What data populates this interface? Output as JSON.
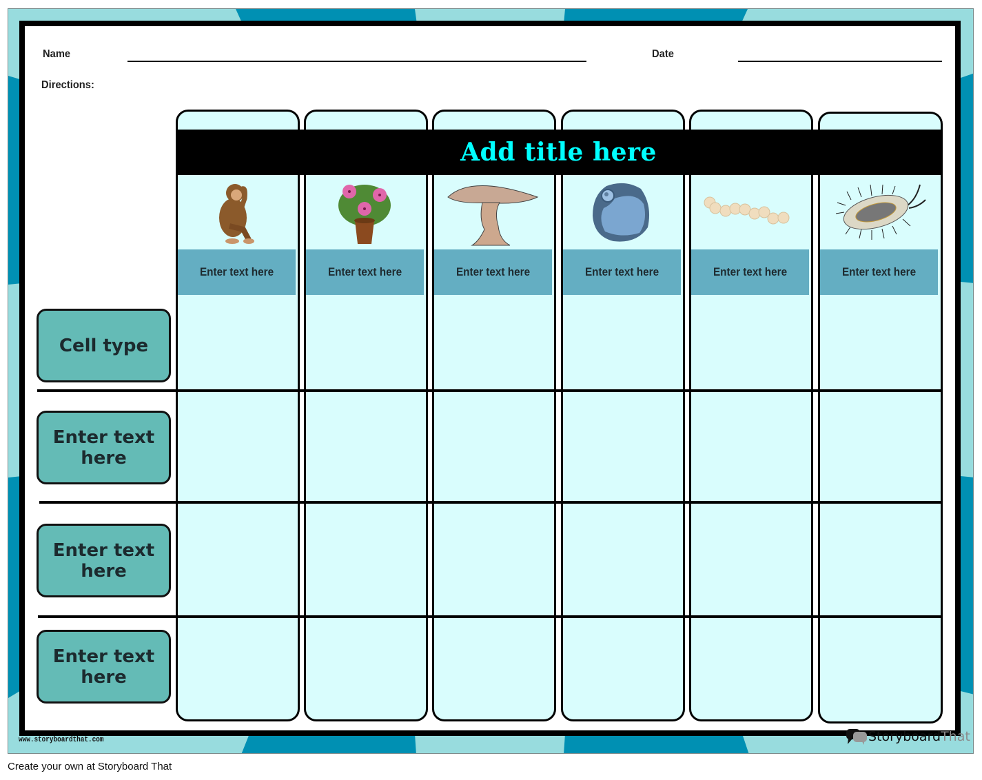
{
  "worksheet": {
    "name_label": "Name",
    "date_label": "Date",
    "directions_label": "Directions:",
    "title": "Add title here",
    "columns": [
      {
        "image": "monkey-icon",
        "header": "Enter text here"
      },
      {
        "image": "potted-flower-icon",
        "header": "Enter text here"
      },
      {
        "image": "mushroom-icon",
        "header": "Enter text here"
      },
      {
        "image": "animal-cell-icon",
        "header": "Enter text here"
      },
      {
        "image": "streptococcus-chain-icon",
        "header": "Enter text here"
      },
      {
        "image": "bacterium-icon",
        "header": "Enter text here"
      }
    ],
    "rows": [
      {
        "label": "Cell type"
      },
      {
        "label": "Enter text here"
      },
      {
        "label": "Enter text here"
      },
      {
        "label": "Enter text here"
      }
    ]
  },
  "branding": {
    "website": "www.storyboardthat.com",
    "logo_part1": "Storyboard",
    "logo_part2": "That",
    "footer": "Create your own at Storyboard That"
  },
  "colors": {
    "frame_light": "#98dcde",
    "frame_dark": "#0090b3",
    "column_fill": "#d9fdfd",
    "header_cell": "#64aec2",
    "row_label": "#64bbb6",
    "title_text": "#00ffff"
  }
}
